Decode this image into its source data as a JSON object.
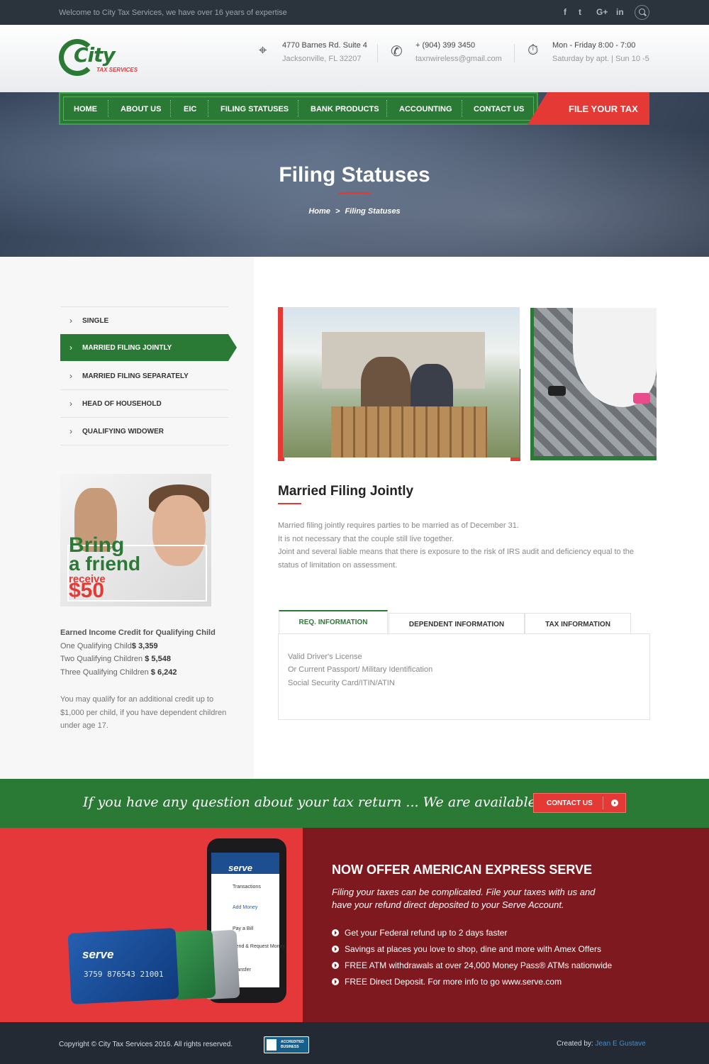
{
  "topbar": {
    "welcome": "Welcome to City Tax Services, we have over 16 years of expertise",
    "social": [
      "f",
      "t",
      "G+",
      "in"
    ]
  },
  "header": {
    "logo_text": "City",
    "logo_sub": "TAX SERVICES",
    "address": {
      "line1": "4770 Barnes Rd. Suite 4",
      "line2": "Jacksonville, FL 32207",
      "icon": "map-pin-icon"
    },
    "contact": {
      "line1": "+ (904) 399 3450",
      "line2": "taxnwireless@gmail.com",
      "icon": "phone-icon"
    },
    "hours": {
      "line1": "Mon - Friday 8:00 - 7:00",
      "line2": "Saturday by apt. | Sun 10 -5",
      "icon": "stopwatch-icon"
    }
  },
  "nav": {
    "items": [
      "HOME",
      "ABOUT US",
      "EIC",
      "FILING STATUSES",
      "BANK PRODUCTS",
      "ACCOUNTING",
      "CONTACT US"
    ],
    "cta": "FILE YOUR TAX"
  },
  "hero": {
    "title": "Filing Statuses",
    "breadcrumb_home": "Home",
    "breadcrumb_sep": ">",
    "breadcrumb_current": "Filing Statuses"
  },
  "sidebar": {
    "items": [
      "SINGLE",
      "MARRIED FILING JOINTLY",
      "MARRIED FILING SEPARATELY",
      "HEAD OF HOUSEHOLD",
      "QUALIFYING WIDOWER"
    ],
    "active_index": 1,
    "promo": {
      "line1": "Bring",
      "line2": "a friend",
      "line3": "receive",
      "line4": "$50"
    },
    "eic": {
      "heading": "Earned Income Credit for Qualifying Child",
      "rows": [
        {
          "label": "One Qualifying Child",
          "value": "$ 3,359"
        },
        {
          "label": "Two Qualifying Children ",
          "value": "$ 5,548"
        },
        {
          "label": "Three Qualifying Children ",
          "value": "$ 6,242"
        }
      ],
      "note": "You may qualify for an additional credit up to $1,000 per child, if you have dependent children under age 17."
    }
  },
  "main": {
    "title": "Married Filing Jointly",
    "paragraphs": [
      "Married filing jointly requires parties to be married as of December 31.",
      "It is not necessary that the couple still live together.",
      "Joint and several liable means that there is exposure to the risk of IRS audit and deficiency equal to the",
      "status of limitation on assessment."
    ],
    "tabs": [
      "REQ. INFORMATION",
      "DEPENDENT INFORMATION",
      "TAX INFORMATION"
    ],
    "active_tab": 0,
    "tab_content": [
      "Valid Driver's License",
      "Or Current Passport/ Military Identification",
      "Social Security Card/ITIN/ATIN"
    ]
  },
  "cta": {
    "text": "If you have any question about your tax return ... We are available",
    "button": "CONTACT US"
  },
  "amex": {
    "title": "NOW OFFER AMERICAN EXPRESS SERVE",
    "subtitle_1": "Filing your taxes can be complicated. File your taxes with us and",
    "subtitle_2": "have your refund direct deposited to your Serve Account.",
    "bullets": [
      "Get your Federal refund up to 2 days faster",
      "Savings at places you love to shop, dine and more with Amex Offers",
      "FREE ATM withdrawals at over 24,000 Money Pass® ATMs nationwide",
      "FREE Direct Deposit. For more info to go www.serve.com"
    ],
    "phone": {
      "brand": "serve",
      "rows": [
        "Transactions",
        "Add Money",
        "Pay a Bill",
        "Send & Request Money",
        "Transfer"
      ]
    },
    "card": {
      "brand": "serve",
      "number": "3759 876543 21001"
    }
  },
  "footer": {
    "copyright": "Copyright © City Tax Services 2016. All rights reserved.",
    "bbb_line1": "ACCREDITED",
    "bbb_line2": "BUSINESS",
    "created_label": "Created by:",
    "created_by": "Jean E Gustave"
  },
  "colors": {
    "green": "#2a7a36",
    "red": "#e53935",
    "dark_red": "#7e1a1f",
    "navy": "#2b333d"
  }
}
